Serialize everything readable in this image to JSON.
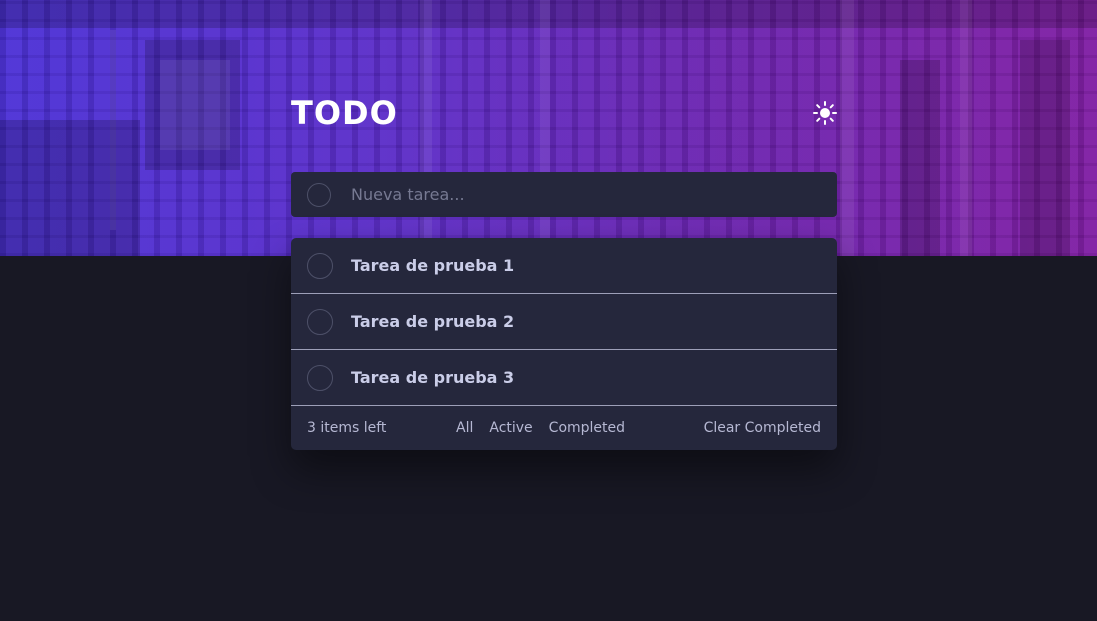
{
  "app": {
    "title": "TODO",
    "theme_toggle_icon": "sun-icon"
  },
  "new_todo": {
    "placeholder": "Nueva tarea...",
    "value": ""
  },
  "todos": [
    {
      "text": "Tarea de prueba 1",
      "completed": false
    },
    {
      "text": "Tarea de prueba 2",
      "completed": false
    },
    {
      "text": "Tarea de prueba 3",
      "completed": false
    }
  ],
  "footer": {
    "items_left": "3 items left",
    "filters": [
      "All",
      "Active",
      "Completed"
    ],
    "clear_label": "Clear Completed"
  },
  "colors": {
    "background": "#181824",
    "card": "#25273c",
    "text": "#cacde8",
    "hero_start": "#4a2fd6",
    "hero_end": "#7e1ca2"
  }
}
